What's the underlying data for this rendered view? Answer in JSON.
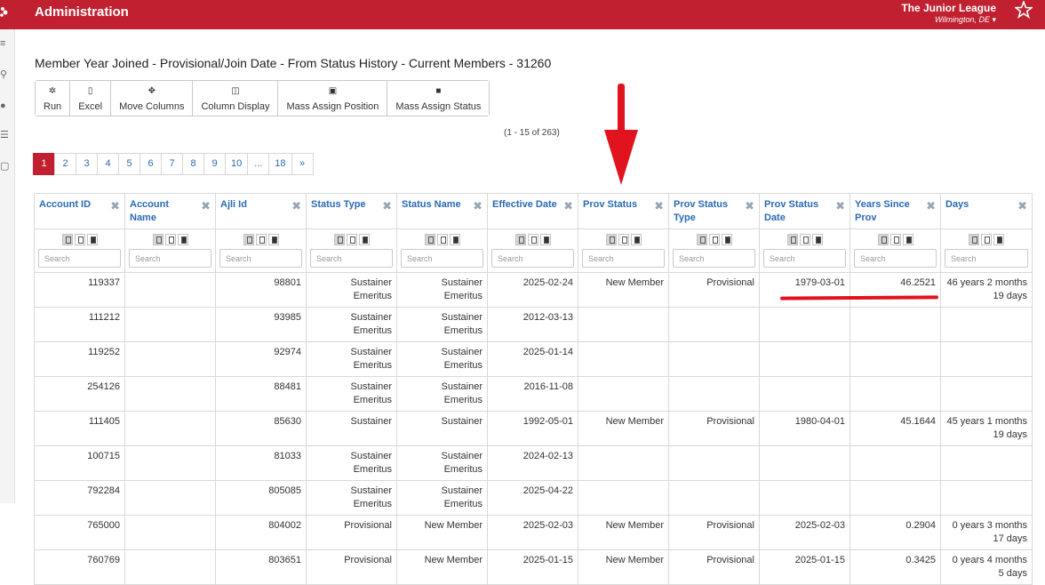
{
  "header": {
    "app_title": "Administration",
    "org_name": "The Junior League",
    "location": "Wilmington, DE ▾"
  },
  "report": {
    "title": "Member Year Joined - Provisional/Join Date - From Status History - Current Members - 31260",
    "count_text": "(1 - 15 of 263)"
  },
  "toolbar": [
    {
      "name": "run",
      "label": "Run",
      "icon": "gear-icon"
    },
    {
      "name": "excel",
      "label": "Excel",
      "icon": "excel-icon"
    },
    {
      "name": "move-columns",
      "label": "Move Columns",
      "icon": "move-icon"
    },
    {
      "name": "column-display",
      "label": "Column Display",
      "icon": "columns-icon"
    },
    {
      "name": "mass-assign-position",
      "label": "Mass Assign Position",
      "icon": "id-card-icon"
    },
    {
      "name": "mass-assign-status",
      "label": "Mass Assign Status",
      "icon": "badge-icon"
    }
  ],
  "pager": [
    "1",
    "2",
    "3",
    "4",
    "5",
    "6",
    "7",
    "8",
    "9",
    "10",
    "...",
    "18",
    "»"
  ],
  "columns": [
    {
      "label": "Account ID"
    },
    {
      "label": "Account Name"
    },
    {
      "label": "Ajli Id"
    },
    {
      "label": "Status Type"
    },
    {
      "label": "Status Name"
    },
    {
      "label": "Effective Date"
    },
    {
      "label": "Prov Status"
    },
    {
      "label": "Prov Status Type"
    },
    {
      "label": "Prov Status Date"
    },
    {
      "label": "Years Since Prov"
    },
    {
      "label": "Days"
    }
  ],
  "search_placeholder": "Search",
  "rows": [
    [
      "119337",
      "",
      "98801",
      "Sustainer Emeritus",
      "Sustainer Emeritus",
      "2025-02-24",
      "New Member",
      "Provisional",
      "1979-03-01",
      "46.2521",
      "46 years 2 months 19 days"
    ],
    [
      "111212",
      "",
      "93985",
      "Sustainer Emeritus",
      "Sustainer Emeritus",
      "2012-03-13",
      "",
      "",
      "",
      "",
      ""
    ],
    [
      "119252",
      "",
      "92974",
      "Sustainer Emeritus",
      "Sustainer Emeritus",
      "2025-01-14",
      "",
      "",
      "",
      "",
      ""
    ],
    [
      "254126",
      "",
      "88481",
      "Sustainer Emeritus",
      "Sustainer Emeritus",
      "2016-11-08",
      "",
      "",
      "",
      "",
      ""
    ],
    [
      "111405",
      "",
      "85630",
      "Sustainer",
      "Sustainer",
      "1992-05-01",
      "New Member",
      "Provisional",
      "1980-04-01",
      "45.1644",
      "45 years 1 months 19 days"
    ],
    [
      "100715",
      "",
      "81033",
      "Sustainer Emeritus",
      "Sustainer Emeritus",
      "2024-02-13",
      "",
      "",
      "",
      "",
      ""
    ],
    [
      "792284",
      "",
      "805085",
      "Sustainer Emeritus",
      "Sustainer Emeritus",
      "2025-04-22",
      "",
      "",
      "",
      "",
      ""
    ],
    [
      "765000",
      "",
      "804002",
      "Provisional",
      "New Member",
      "2025-02-03",
      "New Member",
      "Provisional",
      "2025-02-03",
      "0.2904",
      "0 years 3 months 17 days"
    ],
    [
      "760769",
      "",
      "803651",
      "Provisional",
      "New Member",
      "2025-01-15",
      "New Member",
      "Provisional",
      "2025-01-15",
      "0.3425",
      "0 years 4 months 5 days"
    ]
  ],
  "colors": {
    "brand": "#c0202f",
    "link": "#2a6ab5",
    "annotation": "#e0131f"
  }
}
